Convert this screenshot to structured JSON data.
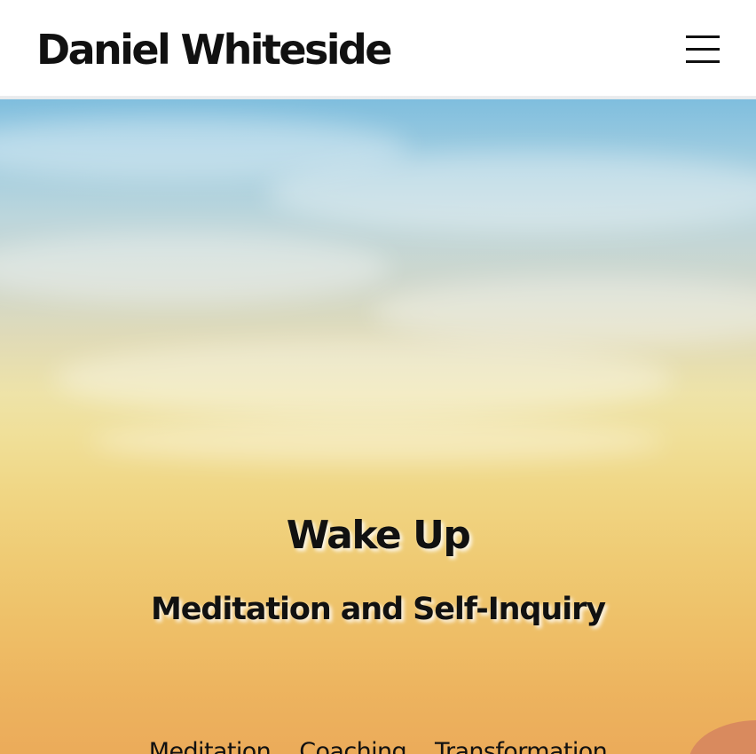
{
  "header": {
    "site_title": "Daniel Whiteside",
    "menu_icon": "hamburger-menu-icon"
  },
  "hero": {
    "title": "Wake Up",
    "subtitle": "Meditation and Self-Inquiry",
    "tagline": [
      "Meditation",
      "Coaching",
      "Transformation"
    ]
  },
  "colors": {
    "text": "#111111",
    "sky_top": "#7fbede",
    "sky_bottom": "#ebab5a"
  }
}
